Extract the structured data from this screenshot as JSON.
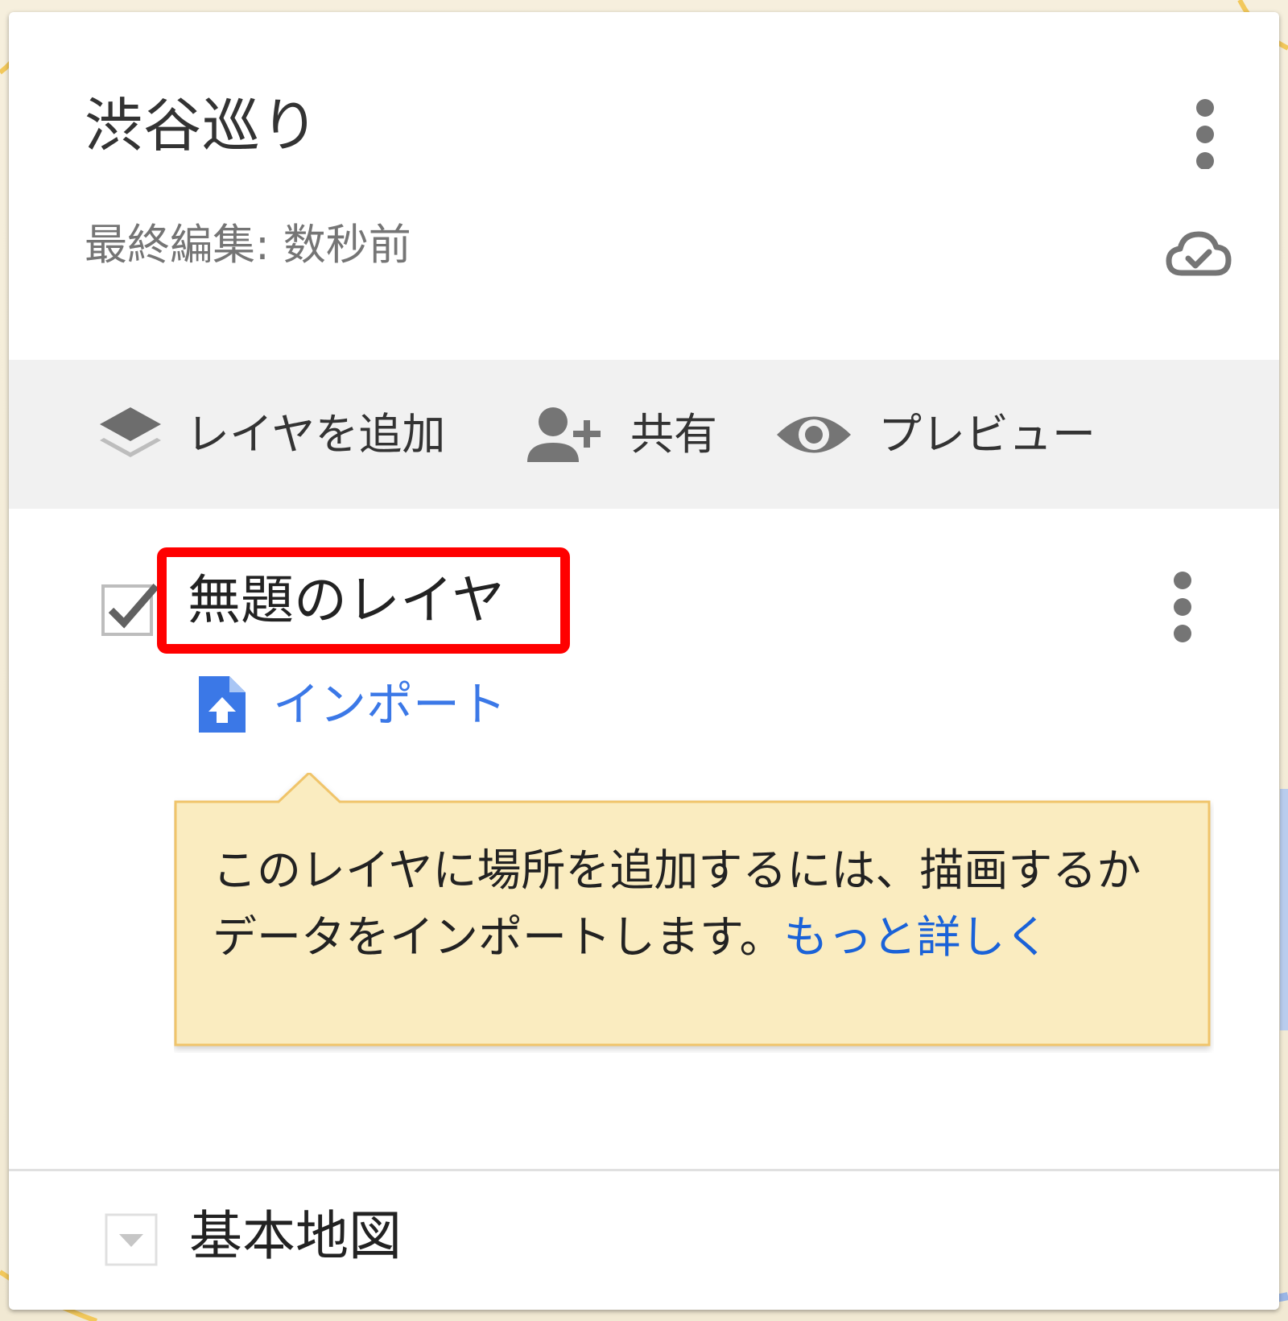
{
  "map": {
    "title": "渋谷巡り",
    "last_edited": "最終編集: 数秒前"
  },
  "toolbar": {
    "add_layer_label": "レイヤを追加",
    "share_label": "共有",
    "preview_label": "プレビュー"
  },
  "layer": {
    "name": "無題のレイヤ",
    "checked": true,
    "import_label": "インポート"
  },
  "tooltip": {
    "message": "このレイヤに場所を追加するには、描画するかデータをインポートします。",
    "link_label": "もっと詳しく"
  },
  "basemap": {
    "label": "基本地図"
  },
  "colors": {
    "link_blue": "#3b78e7",
    "highlight_red": "#ff0000",
    "tooltip_bg": "#faecc0",
    "tooltip_border": "#f0c46a",
    "toolbar_bg": "#f1f1f1"
  },
  "icons": [
    "more-vert-icon",
    "cloud-done-icon",
    "layers-icon",
    "person-add-icon",
    "eye-icon",
    "checkbox-checked-icon",
    "file-upload-icon",
    "dropdown-arrow-icon"
  ]
}
